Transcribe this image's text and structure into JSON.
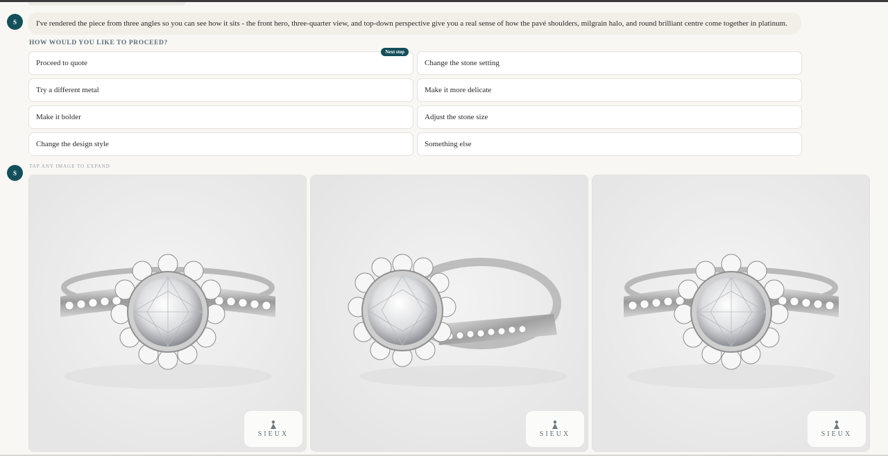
{
  "messages": [
    {
      "avatar": "S",
      "text": "I've rendered the piece from three angles so you can see how it sits - the front hero, three-quarter view, and top-down perspective give you a real sense of how the pavé shoulders, milgrain halo, and round brilliant centre come together in platinum."
    },
    {
      "avatar": "S"
    }
  ],
  "proceed": {
    "label": "HOW WOULD YOU LIKE TO PROCEED?",
    "badge": "Next step",
    "options": [
      "Proceed to quote",
      "Change the stone setting",
      "Try a different metal",
      "Make it more delicate",
      "Make it bolder",
      "Adjust the stone size",
      "Change the design style",
      "Something else"
    ]
  },
  "gallery": {
    "hint": "TAP ANY IMAGE TO EXPAND",
    "images": [
      {
        "subject": "front hero view of platinum halo ring",
        "logo": "SIEUX"
      },
      {
        "subject": "three-quarter view of platinum halo ring",
        "logo": "SIEUX"
      },
      {
        "subject": "top-down view of platinum halo ring",
        "logo": "SIEUX"
      }
    ]
  },
  "colors": {
    "accent": "#144f5a",
    "bubble": "#f2efe8",
    "background": "#f8f7f4",
    "card": "#ededed"
  }
}
